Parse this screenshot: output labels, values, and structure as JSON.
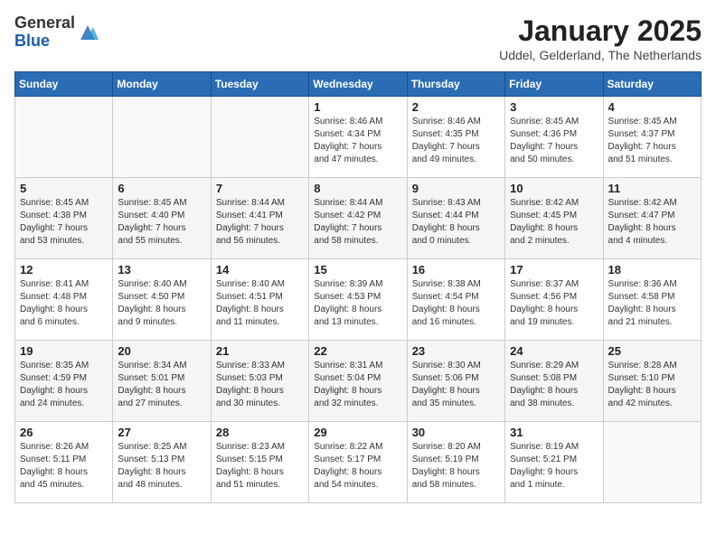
{
  "logo": {
    "general": "General",
    "blue": "Blue"
  },
  "title": "January 2025",
  "location": "Uddel, Gelderland, The Netherlands",
  "weekdays": [
    "Sunday",
    "Monday",
    "Tuesday",
    "Wednesday",
    "Thursday",
    "Friday",
    "Saturday"
  ],
  "weeks": [
    [
      {
        "day": "",
        "info": ""
      },
      {
        "day": "",
        "info": ""
      },
      {
        "day": "",
        "info": ""
      },
      {
        "day": "1",
        "info": "Sunrise: 8:46 AM\nSunset: 4:34 PM\nDaylight: 7 hours\nand 47 minutes."
      },
      {
        "day": "2",
        "info": "Sunrise: 8:46 AM\nSunset: 4:35 PM\nDaylight: 7 hours\nand 49 minutes."
      },
      {
        "day": "3",
        "info": "Sunrise: 8:45 AM\nSunset: 4:36 PM\nDaylight: 7 hours\nand 50 minutes."
      },
      {
        "day": "4",
        "info": "Sunrise: 8:45 AM\nSunset: 4:37 PM\nDaylight: 7 hours\nand 51 minutes."
      }
    ],
    [
      {
        "day": "5",
        "info": "Sunrise: 8:45 AM\nSunset: 4:38 PM\nDaylight: 7 hours\nand 53 minutes."
      },
      {
        "day": "6",
        "info": "Sunrise: 8:45 AM\nSunset: 4:40 PM\nDaylight: 7 hours\nand 55 minutes."
      },
      {
        "day": "7",
        "info": "Sunrise: 8:44 AM\nSunset: 4:41 PM\nDaylight: 7 hours\nand 56 minutes."
      },
      {
        "day": "8",
        "info": "Sunrise: 8:44 AM\nSunset: 4:42 PM\nDaylight: 7 hours\nand 58 minutes."
      },
      {
        "day": "9",
        "info": "Sunrise: 8:43 AM\nSunset: 4:44 PM\nDaylight: 8 hours\nand 0 minutes."
      },
      {
        "day": "10",
        "info": "Sunrise: 8:42 AM\nSunset: 4:45 PM\nDaylight: 8 hours\nand 2 minutes."
      },
      {
        "day": "11",
        "info": "Sunrise: 8:42 AM\nSunset: 4:47 PM\nDaylight: 8 hours\nand 4 minutes."
      }
    ],
    [
      {
        "day": "12",
        "info": "Sunrise: 8:41 AM\nSunset: 4:48 PM\nDaylight: 8 hours\nand 6 minutes."
      },
      {
        "day": "13",
        "info": "Sunrise: 8:40 AM\nSunset: 4:50 PM\nDaylight: 8 hours\nand 9 minutes."
      },
      {
        "day": "14",
        "info": "Sunrise: 8:40 AM\nSunset: 4:51 PM\nDaylight: 8 hours\nand 11 minutes."
      },
      {
        "day": "15",
        "info": "Sunrise: 8:39 AM\nSunset: 4:53 PM\nDaylight: 8 hours\nand 13 minutes."
      },
      {
        "day": "16",
        "info": "Sunrise: 8:38 AM\nSunset: 4:54 PM\nDaylight: 8 hours\nand 16 minutes."
      },
      {
        "day": "17",
        "info": "Sunrise: 8:37 AM\nSunset: 4:56 PM\nDaylight: 8 hours\nand 19 minutes."
      },
      {
        "day": "18",
        "info": "Sunrise: 8:36 AM\nSunset: 4:58 PM\nDaylight: 8 hours\nand 21 minutes."
      }
    ],
    [
      {
        "day": "19",
        "info": "Sunrise: 8:35 AM\nSunset: 4:59 PM\nDaylight: 8 hours\nand 24 minutes."
      },
      {
        "day": "20",
        "info": "Sunrise: 8:34 AM\nSunset: 5:01 PM\nDaylight: 8 hours\nand 27 minutes."
      },
      {
        "day": "21",
        "info": "Sunrise: 8:33 AM\nSunset: 5:03 PM\nDaylight: 8 hours\nand 30 minutes."
      },
      {
        "day": "22",
        "info": "Sunrise: 8:31 AM\nSunset: 5:04 PM\nDaylight: 8 hours\nand 32 minutes."
      },
      {
        "day": "23",
        "info": "Sunrise: 8:30 AM\nSunset: 5:06 PM\nDaylight: 8 hours\nand 35 minutes."
      },
      {
        "day": "24",
        "info": "Sunrise: 8:29 AM\nSunset: 5:08 PM\nDaylight: 8 hours\nand 38 minutes."
      },
      {
        "day": "25",
        "info": "Sunrise: 8:28 AM\nSunset: 5:10 PM\nDaylight: 8 hours\nand 42 minutes."
      }
    ],
    [
      {
        "day": "26",
        "info": "Sunrise: 8:26 AM\nSunset: 5:11 PM\nDaylight: 8 hours\nand 45 minutes."
      },
      {
        "day": "27",
        "info": "Sunrise: 8:25 AM\nSunset: 5:13 PM\nDaylight: 8 hours\nand 48 minutes."
      },
      {
        "day": "28",
        "info": "Sunrise: 8:23 AM\nSunset: 5:15 PM\nDaylight: 8 hours\nand 51 minutes."
      },
      {
        "day": "29",
        "info": "Sunrise: 8:22 AM\nSunset: 5:17 PM\nDaylight: 8 hours\nand 54 minutes."
      },
      {
        "day": "30",
        "info": "Sunrise: 8:20 AM\nSunset: 5:19 PM\nDaylight: 8 hours\nand 58 minutes."
      },
      {
        "day": "31",
        "info": "Sunrise: 8:19 AM\nSunset: 5:21 PM\nDaylight: 9 hours\nand 1 minute."
      },
      {
        "day": "",
        "info": ""
      }
    ]
  ]
}
